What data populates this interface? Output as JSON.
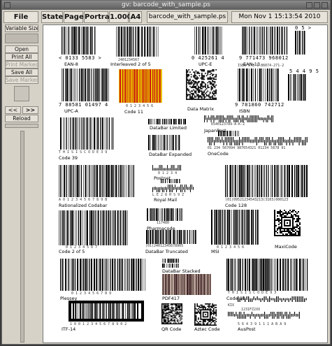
{
  "window": {
    "title": "gv: barcode_with_sample.ps"
  },
  "toolbar": {
    "file": "File",
    "state": "State",
    "page": "Page",
    "orientation": "Portrait",
    "zoom": "1.000",
    "media": "A4",
    "filename": "barcode_with_sample.ps",
    "datetime": "Mon Nov  1 15:13:54 2010"
  },
  "sidebar": {
    "variable_size": "Variable Size",
    "open": "Open",
    "print_all": "Print All",
    "print_marked": "Print Marked",
    "save_all": "Save All",
    "save_marked": "Save Marked",
    "prev": "<<",
    "next": ">>",
    "reload": "Reload"
  },
  "barcodes": {
    "ean8": {
      "label": "EAN-8",
      "text": "< 0133 5583 >"
    },
    "i2of5": {
      "label": "Interleaved 2 of 5",
      "text": "2401234567"
    },
    "upce": {
      "label": "UPC-E",
      "text": "0 425261 4"
    },
    "ean13": {
      "label": "EAN-13",
      "text": "9 771473 968012",
      "addon": "0 5 >"
    },
    "upca": {
      "label": "UPC-A",
      "text": "7 88581 01497 4"
    },
    "code11": {
      "label": "Code 11",
      "text": "0 1 2 3 4 5 6"
    },
    "datamatrix": {
      "label": "Data Matrix"
    },
    "isbn": {
      "label": "ISBN",
      "text": "9 781860 742712",
      "top": "ISBN 978-1-86074-271-2",
      "addon": "5 4 4 9 5"
    },
    "databar_limited": {
      "label": "DataBar Limited"
    },
    "japanpost": {
      "label": "JapanPost",
      "text": "6540123789-A-K-Z"
    },
    "code39": {
      "label": "Code 39",
      "text": "T H I S   I S   C O D E   3 9"
    },
    "databar_expanded": {
      "label": "DataBar Expanded"
    },
    "onecode": {
      "label": "OneCode",
      "text": "01 234 567094 987654321 01234 5678 91"
    },
    "postnet": {
      "label": "Postnet",
      "text": "0 1 2 3 4"
    },
    "royalmail": {
      "label": "Royal Mail",
      "text": "L E 2 8 H S 9 Z"
    },
    "rationalized": {
      "label": "Rationalized Codabar",
      "text": "A 0 1 2 3 4 5 6 7 8 9 B"
    },
    "code128": {
      "label": "Code 128",
      "text": "(01)09521234543213(3103)000123"
    },
    "pharmacode": {
      "label": "Pharmacode",
      "text": "117480"
    },
    "maxicode": {
      "label": "MaxiCode"
    },
    "code2of5": {
      "label": "Code 2 of 5",
      "text": "0 1 2 3 4 5 6 7"
    },
    "databar_truncated": {
      "label": "DataBar Truncated",
      "text": "(01)24012345678905"
    },
    "msi": {
      "label": "MSI",
      "text": "0 1 2 3 4 5 6"
    },
    "databar_stacked": {
      "label": "DataBar Stacked"
    },
    "plessey": {
      "label": "Plessey",
      "text": "0 1 2 3 4 5 6 7 8 9"
    },
    "pdf417": {
      "label": "PDF417"
    },
    "code93": {
      "label": "Code 93",
      "text": "T H I S   I S   C O D E   9 3"
    },
    "itf14": {
      "label": "ITF-14",
      "text": "1 0 0 1 2 3 4 5 6 7 8 9 0 2"
    },
    "qrcode": {
      "label": "QR Code"
    },
    "aztec": {
      "label": "Aztec Code"
    },
    "auspost": {
      "label": "AusPost",
      "text": "5 6 4 3 9 1 1 1 A B A 9"
    },
    "kix": {
      "label": "KIX",
      "text": "1231FZ2XX"
    }
  },
  "colors": {
    "code11_bg": "#e8c400",
    "code11_bar": "#cc1a10"
  }
}
